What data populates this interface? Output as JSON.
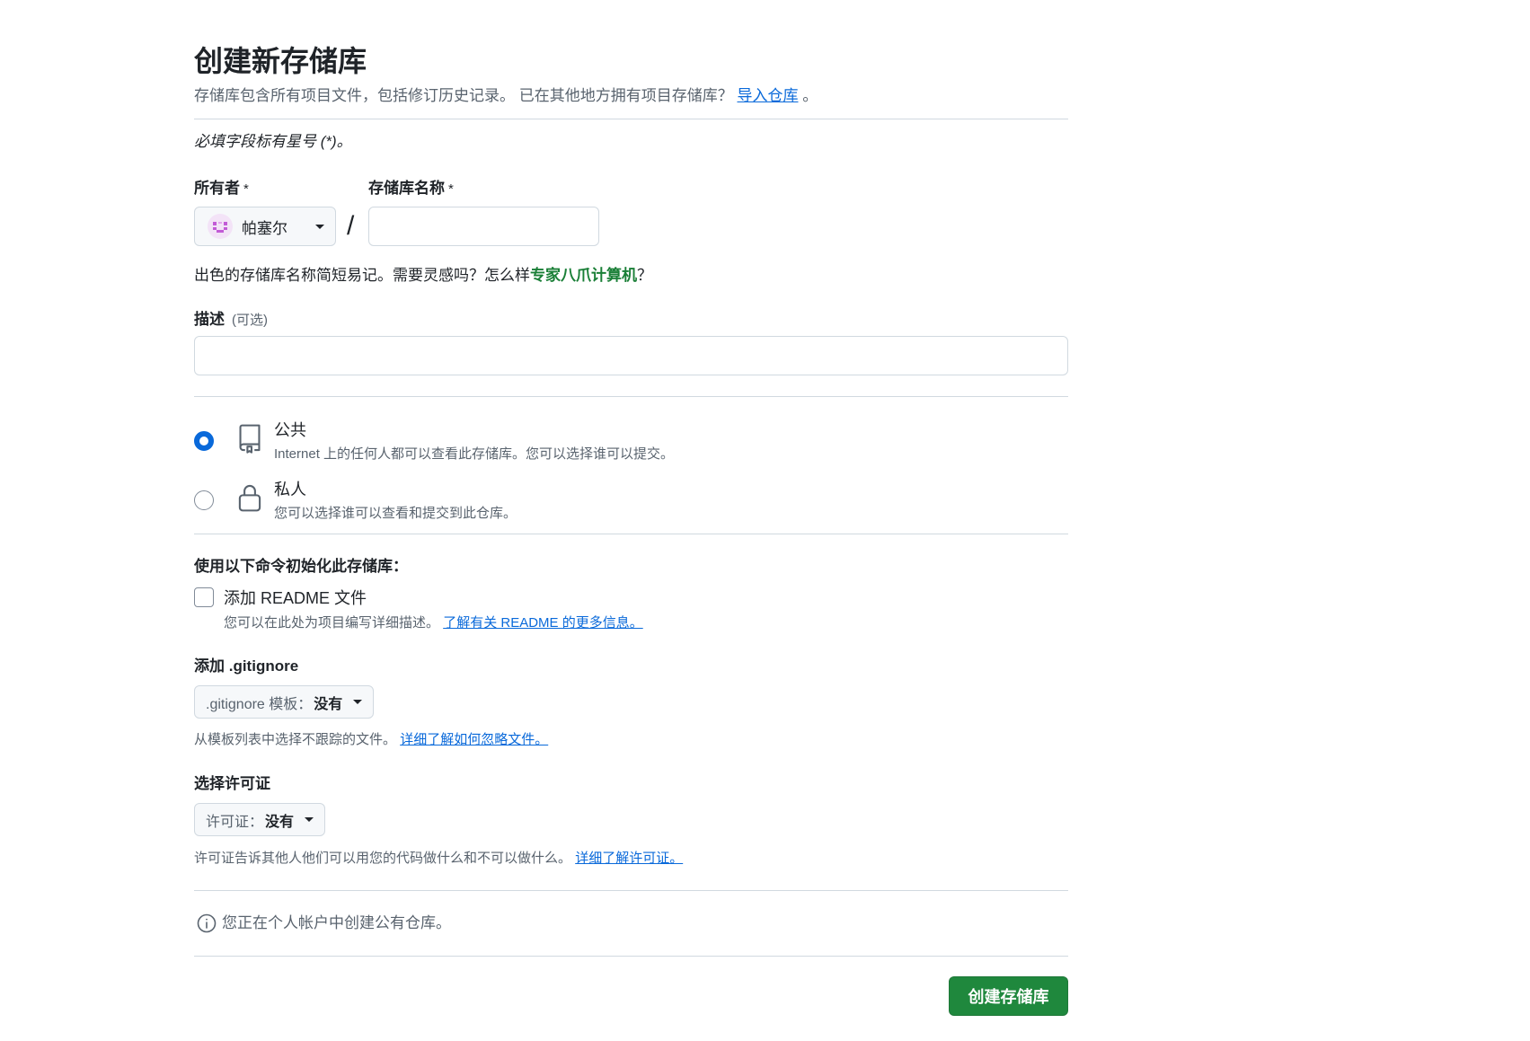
{
  "page": {
    "title": "创建新存储库",
    "subtitle": "存储库包含所有项目文件，包括修订历史记录。 已在其他地方拥有项目存储库？",
    "import_link": "导入仓库",
    "subtitle_end": "。",
    "required_note": "必填字段标有星号 (*)。"
  },
  "owner": {
    "label": "所有者",
    "required": "*",
    "value": "帕塞尔",
    "avatar_icon": "pixel-avatar-icon"
  },
  "repo_name": {
    "label": "存储库名称",
    "required": "*",
    "separator": "/",
    "value": ""
  },
  "name_hint": {
    "text": "出色的存储库名称简短易记。需要灵感吗？怎么样",
    "suggestion": "专家八爪计算机",
    "end": "？"
  },
  "description": {
    "label": "描述",
    "optional": "(可选)",
    "value": ""
  },
  "visibility": {
    "options": [
      {
        "label": "公共",
        "description": "Internet 上的任何人都可以查看此存储库。您可以选择谁可以提交。",
        "selected": true,
        "icon": "repo-icon"
      },
      {
        "label": "私人",
        "description": "您可以选择谁可以查看和提交到此仓库。",
        "selected": false,
        "icon": "lock-icon"
      }
    ]
  },
  "init": {
    "heading": "使用以下命令初始化此存储库：",
    "readme_label": "添加 README 文件",
    "readme_checked": false,
    "readme_desc": "您可以在此处为项目编写详细描述。",
    "readme_link": "了解有关 README 的更多信息。"
  },
  "gitignore": {
    "heading": "添加 .gitignore",
    "prefix": ".gitignore 模板：",
    "value": "没有",
    "help": "从模板列表中选择不跟踪的文件。",
    "link": "详细了解如何忽略文件。"
  },
  "license": {
    "heading": "选择许可证",
    "prefix": "许可证：",
    "value": "没有",
    "help": "许可证告诉其他人他们可以用您的代码做什么和不可以做什么。",
    "link": "详细了解许可证。"
  },
  "info": {
    "text": "您正在个人帐户中创建公有仓库。",
    "icon": "info-icon"
  },
  "submit": {
    "label": "创建存储库"
  },
  "colors": {
    "link": "#0969da",
    "green_text": "#1a7f37",
    "button_green": "#1f883d",
    "text": "#1f2328",
    "muted": "#59636e",
    "border": "#d1d9e0"
  }
}
